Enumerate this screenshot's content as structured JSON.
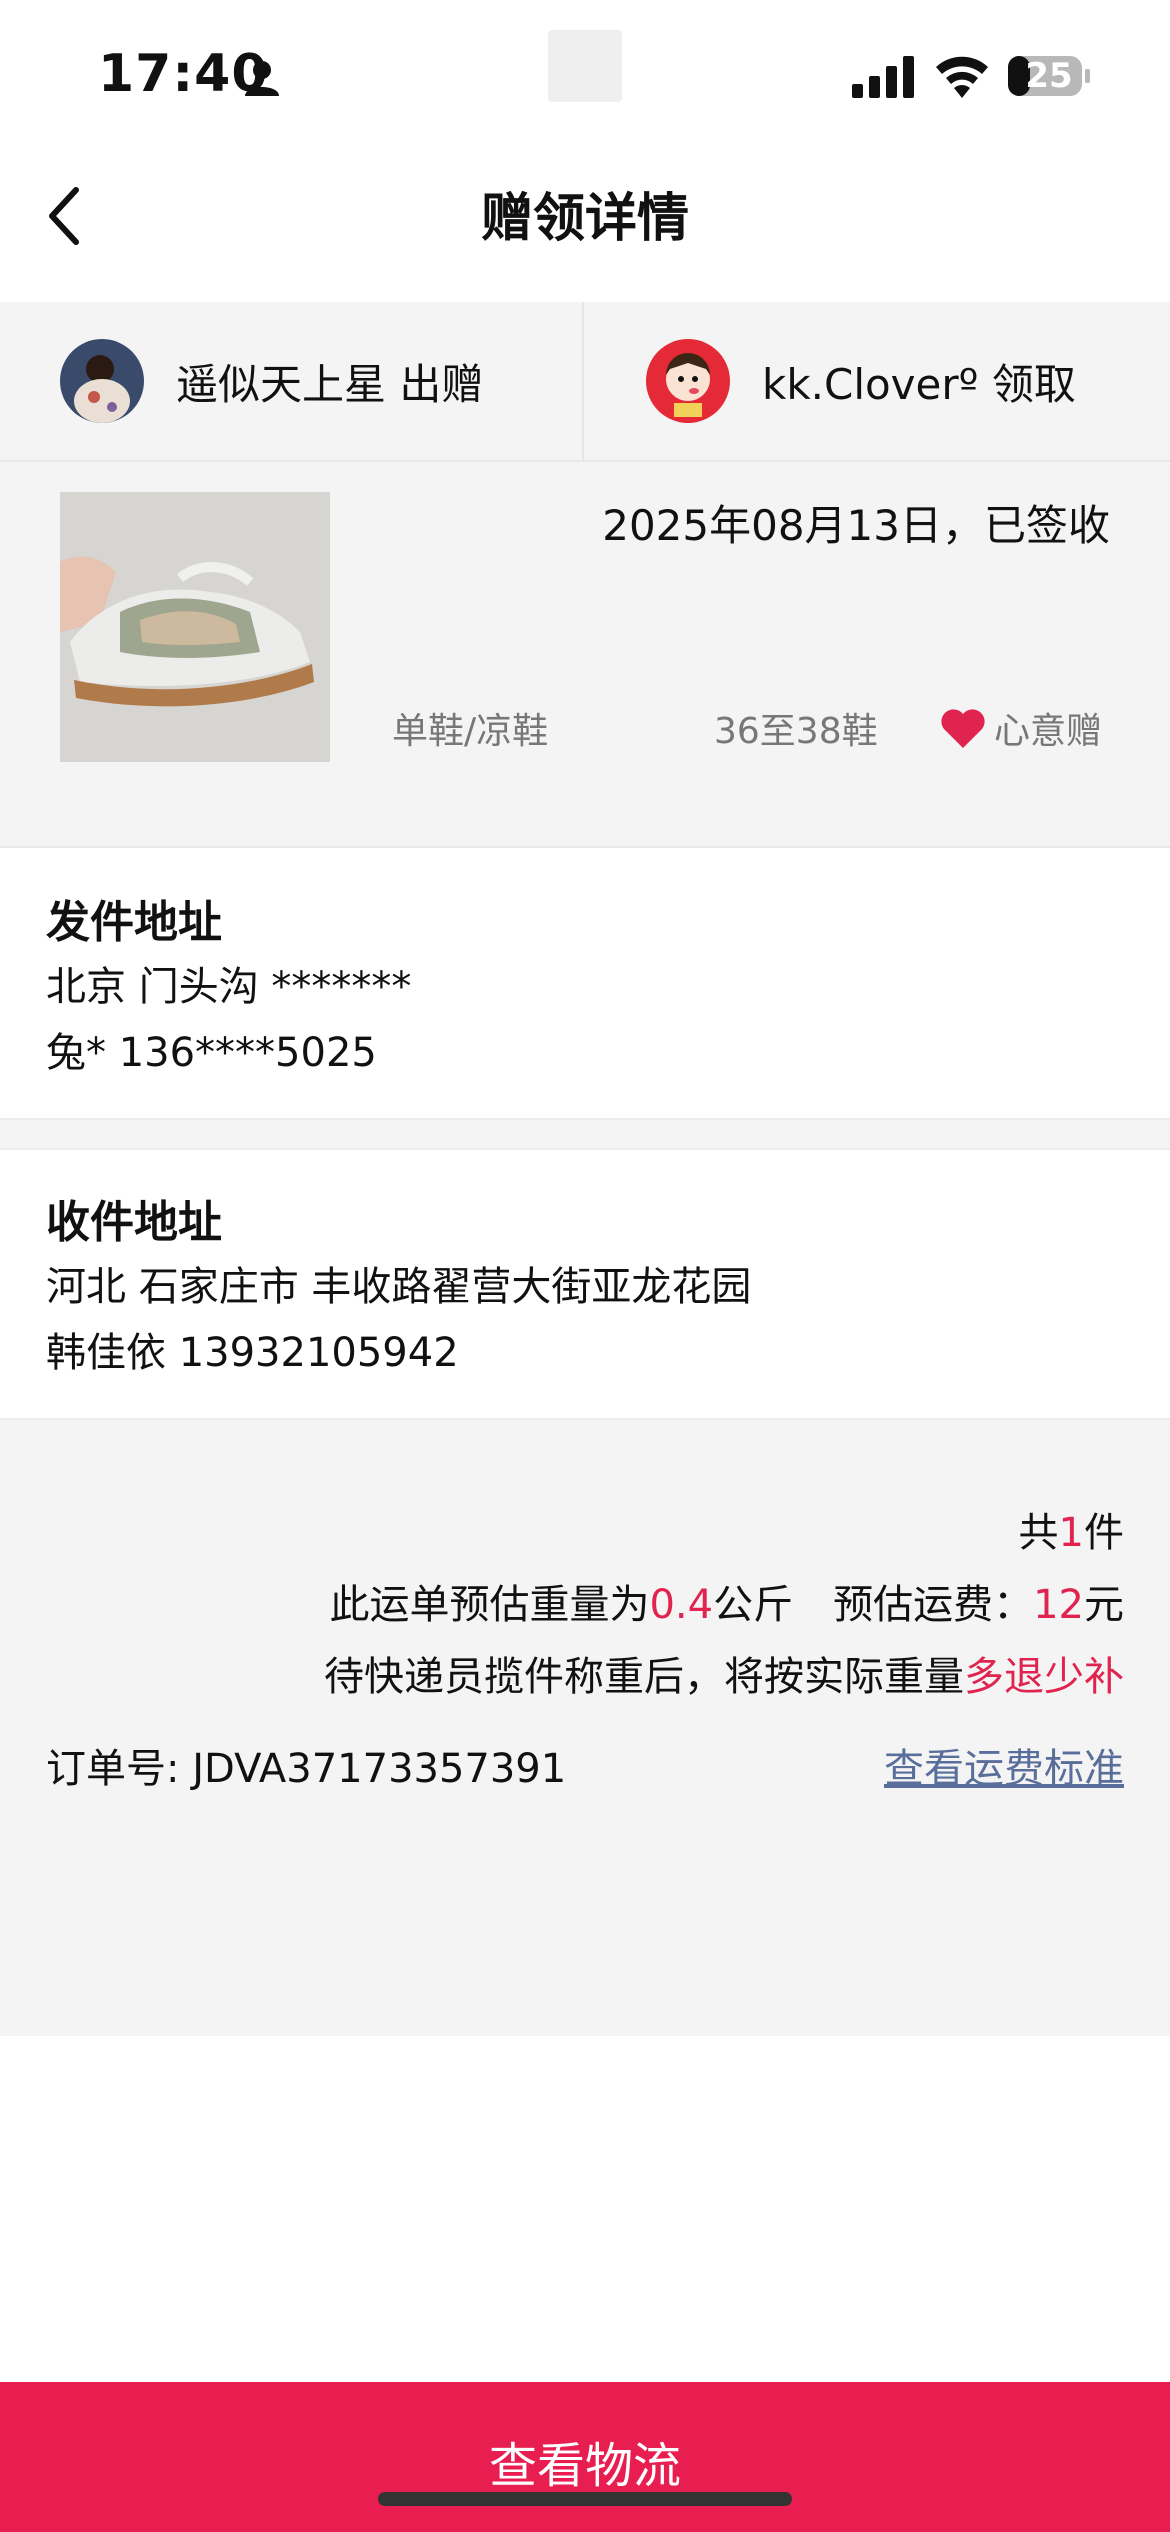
{
  "status_bar": {
    "time": "17:40",
    "battery": "25"
  },
  "header": {
    "title": "赠领详情"
  },
  "users": {
    "giver": {
      "name": "遥似天上星",
      "action": "出赠"
    },
    "receiver": {
      "name": "kk.Cloverº",
      "action": "领取"
    }
  },
  "item": {
    "status": "2025年08月13日，已签收",
    "category": "单鞋/凉鞋",
    "size": "36至38鞋",
    "tag": "心意赠"
  },
  "sender": {
    "heading": "发件地址",
    "address": "北京 门头沟 *******",
    "contact": "兔* 136****5025"
  },
  "receiver": {
    "heading": "收件地址",
    "address": "河北 石家庄市 丰收路翟营大街亚龙花园",
    "contact": "韩佳依 13932105942"
  },
  "summary": {
    "count_prefix": "共",
    "count": "1",
    "count_suffix": "件",
    "weight_prefix": "此运单预估重量为",
    "weight": "0.4",
    "weight_unit": "公斤",
    "fee_label": "预估运费：",
    "fee": "12",
    "fee_unit": "元",
    "note_prefix": "待快递员揽件称重后，将按实际重量",
    "note_highlight": "多退少补",
    "order_label": "订单号:",
    "order_number": "JDVA37173357391",
    "fee_standard_link": "查看运费标准"
  },
  "footer": {
    "button_label": "查看物流"
  },
  "colors": {
    "accent": "#e91e50",
    "price_red": "#e0244f",
    "link": "#5a6e9c",
    "background_gray": "#f4f4f4"
  }
}
